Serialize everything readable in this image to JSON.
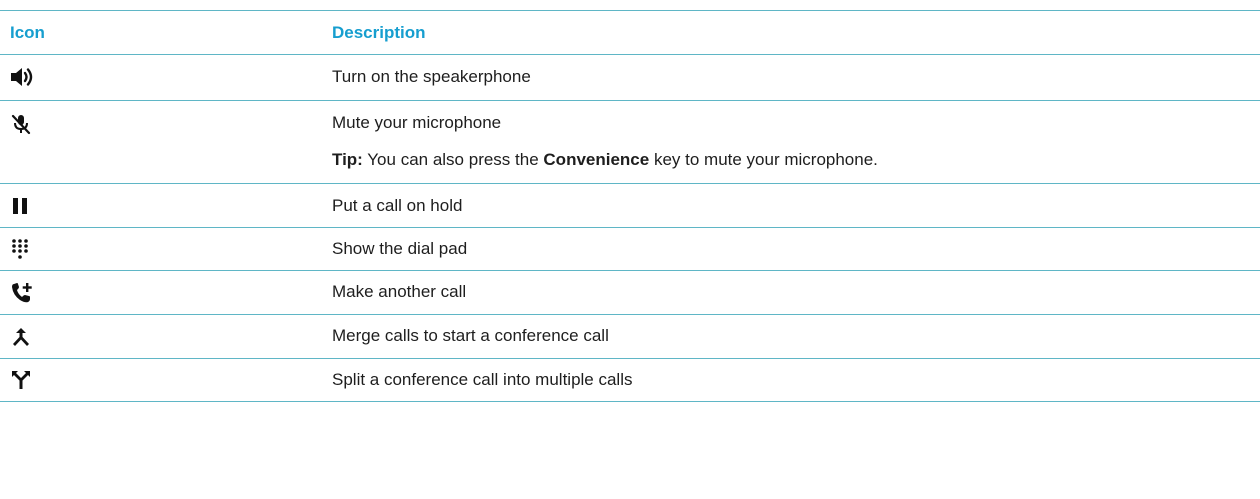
{
  "header": {
    "icon_col": "Icon",
    "desc_col": "Description"
  },
  "rows": [
    {
      "icon": "speakerphone-icon",
      "description": "Turn on the speakerphone"
    },
    {
      "icon": "mute-microphone-icon",
      "description": "Mute your microphone",
      "tip": {
        "label": "Tip:",
        "before": "You can also press the",
        "key": "Convenience",
        "after": "key to mute your microphone."
      }
    },
    {
      "icon": "pause-icon",
      "description": "Put a call on hold"
    },
    {
      "icon": "dial-pad-icon",
      "description": "Show the dial pad"
    },
    {
      "icon": "add-call-icon",
      "description": "Make another call"
    },
    {
      "icon": "merge-calls-icon",
      "description": "Merge calls to start a conference call"
    },
    {
      "icon": "split-call-icon",
      "description": "Split a conference call into multiple calls"
    }
  ],
  "colors": {
    "header_text": "#169ecf",
    "divider": "#5fb6c6",
    "body_text": "#1e1e1e"
  }
}
